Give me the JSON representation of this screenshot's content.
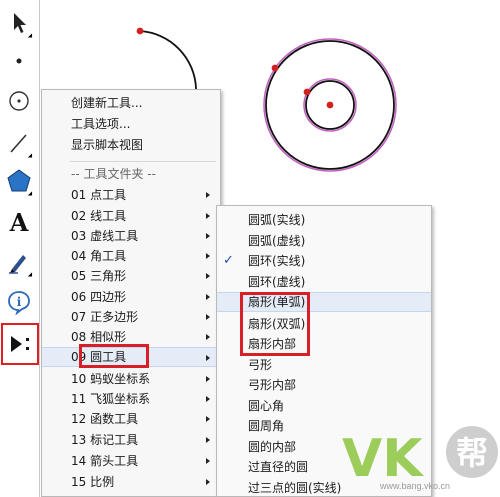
{
  "toolbar": {
    "tools": [
      {
        "name": "arrow-tool",
        "icon": "arrow-icon"
      },
      {
        "name": "point-tool",
        "icon": "point-icon"
      },
      {
        "name": "compass-tool",
        "icon": "compass-icon"
      },
      {
        "name": "line-tool",
        "icon": "line-icon"
      },
      {
        "name": "polygon-tool",
        "icon": "polygon-icon"
      },
      {
        "name": "text-tool",
        "icon": "text-icon",
        "glyph": "A"
      },
      {
        "name": "marker-tool",
        "icon": "pen-icon"
      },
      {
        "name": "info-tool",
        "icon": "info-icon",
        "glyph": "i"
      },
      {
        "name": "custom-tool",
        "icon": "play-colon-icon"
      }
    ]
  },
  "main_menu": {
    "top_items": [
      "创建新工具...",
      "工具选项...",
      "显示脚本视图"
    ],
    "folder_header": "-- 工具文件夹 --",
    "folders": [
      "01 点工具",
      "02 线工具",
      "03 虚线工具",
      "04 角工具",
      "05 三角形",
      "06 四边形",
      "07 正多边形",
      "08 相似形",
      "09 圆工具",
      "10 蚂蚁坐标系",
      "11 飞狐坐标系",
      "12 函数工具",
      "13 标记工具",
      "14 箭头工具",
      "15 比例"
    ],
    "active_index": 8
  },
  "sub_menu": {
    "items": [
      "圆弧(实线)",
      "圆弧(虚线)",
      "圆环(实线)",
      "圆环(虚线)",
      "扇形(单弧)",
      "扇形(双弧)",
      "扇形内部",
      "弓形",
      "弓形内部",
      "圆心角",
      "圆周角",
      "圆的内部",
      "过直径的圆",
      "过三点的圆(实线)"
    ],
    "checked_index": 2,
    "hover_index": 4,
    "check_mark": "✓"
  },
  "watermark": {
    "letters": "VK",
    "badge": "帮",
    "url": "www.bang.vko.cn"
  },
  "colors": {
    "highlight_red": "#d61f26",
    "point_red": "#d42020",
    "ring_pink": "#c060c0",
    "wm_green": "#8cc63f",
    "wm_gray": "#c9c9c9"
  }
}
